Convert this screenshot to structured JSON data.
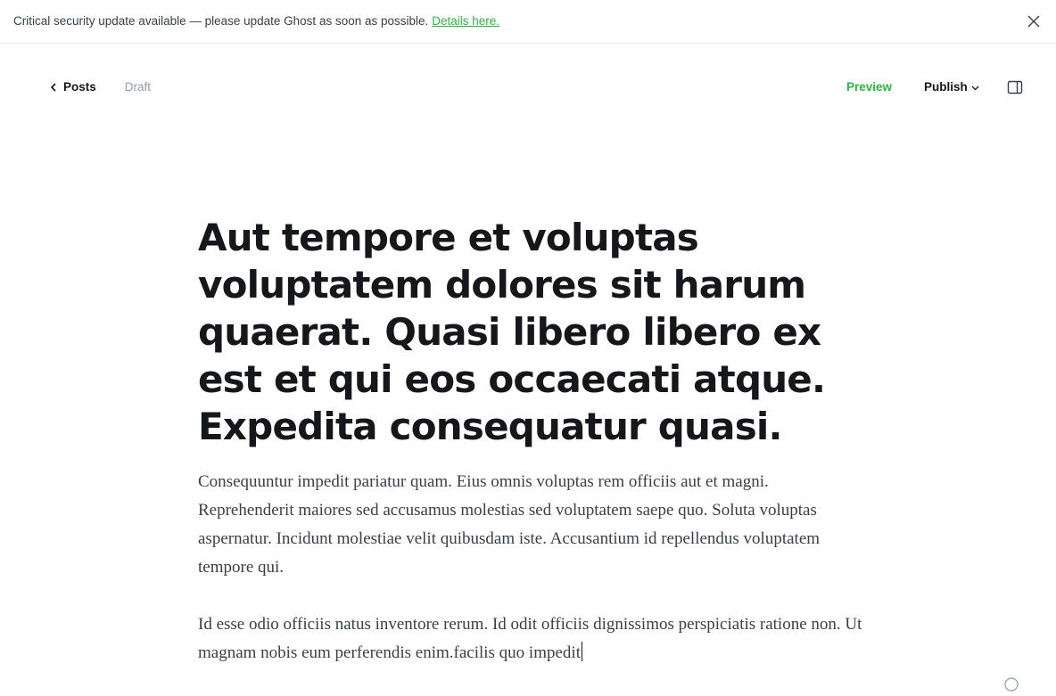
{
  "banner": {
    "message": "Critical security update available — please update Ghost as soon as possible.",
    "link_text": "Details here.",
    "close_icon": "close-icon"
  },
  "toolbar": {
    "back_label": "Posts",
    "back_icon": "chevron-left-icon",
    "status": "Draft",
    "preview_label": "Preview",
    "publish_label": "Publish",
    "publish_icon": "chevron-down-icon",
    "sidebar_icon": "sidebar-toggle-icon"
  },
  "post": {
    "title": "Aut tempore et voluptas voluptatem dolores sit harum quaerat. Quasi libero libero ex est et qui eos occaecati atque. Expedita consequatur quasi.",
    "paragraphs": [
      "Consequuntur impedit pariatur quam. Eius omnis voluptas rem officiis aut et magni. Reprehenderit maiores sed accusamus molestias sed voluptatem saepe quo. Soluta voluptas aspernatur. Incidunt molestiae velit quibusdam iste. Accusantium id repellendus voluptatem tempore qui.",
      "Id esse odio officiis natus inventore rerum. Id odit officiis dignissimos perspiciatis ratione non. Ut magnam nobis eum perferendis enim.facilis quo impedit"
    ]
  },
  "footer": {
    "help_icon": "help-icon"
  },
  "colors": {
    "accent_green": "#2fb344",
    "text_dark": "#15171a",
    "text_muted": "#8e9cac"
  }
}
